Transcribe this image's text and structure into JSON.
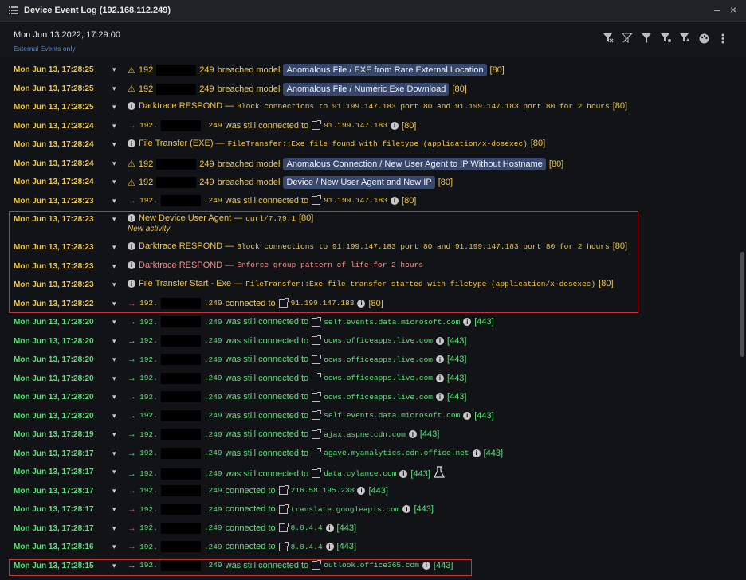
{
  "window": {
    "title": "Device Event Log (192.168.112.249)",
    "minimize": "–",
    "close": "×"
  },
  "header": {
    "date": "Mon Jun 13 2022, 17:29:00",
    "filter": "External Events only"
  },
  "toolbar": {
    "icons": [
      "filter-remove-icon",
      "filter-clear-icon",
      "filter-icon",
      "filter-models-icon",
      "filter-breach-icon",
      "palette-icon",
      "more-vert-icon"
    ]
  },
  "colors": {
    "timestamp_model": "#f0c84a",
    "timestamp_connection": "#5ee07a",
    "model_pill": "#37476e",
    "highlight_box": "#c8372f",
    "respond_text": "#f19090"
  },
  "rows": [
    {
      "time": "Mon Jun 13, 17:28:25",
      "ip_prefix": "192",
      "ip_suffix": "249",
      "text": "breached model",
      "model": "Anomalous File / EXE from Rare External Location",
      "score": "[80]"
    },
    {
      "time": "Mon Jun 13, 17:28:25",
      "ip_prefix": "192",
      "ip_suffix": "249",
      "text": "breached model",
      "model": "Anomalous File / Numeric Exe Download",
      "score": "[80]"
    },
    {
      "time": "Mon Jun 13, 17:28:25",
      "label": "Darktrace RESPOND —",
      "detail": "Block connections to 91.199.147.183 port 80 and 91.199.147.183 port 80 for 2 hours",
      "score": "[80]"
    },
    {
      "time": "Mon Jun 13, 17:28:24",
      "ip_prefix": "192.",
      "ip_suffix": ".249",
      "text": "was still connected to",
      "dest": "91.199.147.183",
      "score": "[80]"
    },
    {
      "time": "Mon Jun 13, 17:28:24",
      "label": "File Transfer (EXE) —",
      "detail": "FileTransfer::Exe file found with filetype (application/x-dosexec)",
      "score": "[80]"
    },
    {
      "time": "Mon Jun 13, 17:28:24",
      "ip_prefix": "192",
      "ip_suffix": "249",
      "text": "breached model",
      "model": "Anomalous Connection / New User Agent to IP Without Hostname",
      "score": "[80]"
    },
    {
      "time": "Mon Jun 13, 17:28:24",
      "ip_prefix": "192",
      "ip_suffix": "249",
      "text": "breached model",
      "model": "Device / New User Agent and New IP",
      "score": "[80]"
    },
    {
      "time": "Mon Jun 13, 17:28:23",
      "ip_prefix": "192.",
      "ip_suffix": ".249",
      "text": "was still connected to",
      "dest": "91.199.147.183",
      "score": "[80]"
    },
    {
      "time": "Mon Jun 13, 17:28:23",
      "label": "New Device User Agent —",
      "detail": "curl/7.79.1",
      "score": "[80]",
      "note": "New activity"
    },
    {
      "time": "Mon Jun 13, 17:28:23",
      "label": "Darktrace RESPOND —",
      "detail": "Block connections to 91.199.147.183 port 80 and 91.199.147.183 port 80 for 2 hours",
      "score": "[80]"
    },
    {
      "time": "Mon Jun 13, 17:28:23",
      "label": "Darktrace RESPOND —",
      "detail": "Enforce group pattern of life for 2 hours"
    },
    {
      "time": "Mon Jun 13, 17:28:23",
      "label": "File Transfer Start - Exe —",
      "detail": "FileTransfer::Exe file transfer started with filetype (application/x-dosexec)",
      "score": "[80]"
    },
    {
      "time": "Mon Jun 13, 17:28:22",
      "ip_prefix": "192.",
      "ip_suffix": ".249",
      "text": "connected to",
      "dest": "91.199.147.183",
      "score": "[80]"
    },
    {
      "time": "Mon Jun 13, 17:28:20",
      "ip_prefix": "192.",
      "ip_suffix": ".249",
      "text": "was still connected to",
      "dest": "self.events.data.microsoft.com",
      "score": "[443]"
    },
    {
      "time": "Mon Jun 13, 17:28:20",
      "ip_prefix": "192.",
      "ip_suffix": ".249",
      "text": "was still connected to",
      "dest": "ocws.officeapps.live.com",
      "score": "[443]"
    },
    {
      "time": "Mon Jun 13, 17:28:20",
      "ip_prefix": "192.",
      "ip_suffix": ".249",
      "text": "was still connected to",
      "dest": "ocws.officeapps.live.com",
      "score": "[443]"
    },
    {
      "time": "Mon Jun 13, 17:28:20",
      "ip_prefix": "192.",
      "ip_suffix": ".249",
      "text": "was still connected to",
      "dest": "ocws.officeapps.live.com",
      "score": "[443]"
    },
    {
      "time": "Mon Jun 13, 17:28:20",
      "ip_prefix": "192.",
      "ip_suffix": ".249",
      "text": "was still connected to",
      "dest": "ocws.officeapps.live.com",
      "score": "[443]"
    },
    {
      "time": "Mon Jun 13, 17:28:20",
      "ip_prefix": "192.",
      "ip_suffix": ".249",
      "text": "was still connected to",
      "dest": "self.events.data.microsoft.com",
      "score": "[443]"
    },
    {
      "time": "Mon Jun 13, 17:28:19",
      "ip_prefix": "192.",
      "ip_suffix": ".249",
      "text": "was still connected to",
      "dest": "ajax.aspnetcdn.com",
      "score": "[443]"
    },
    {
      "time": "Mon Jun 13, 17:28:17",
      "ip_prefix": "192.",
      "ip_suffix": ".249",
      "text": "was still connected to",
      "dest": "agave.myanalytics.cdn.office.net",
      "score": "[443]"
    },
    {
      "time": "Mon Jun 13, 17:28:17",
      "ip_prefix": "192.",
      "ip_suffix": ".249",
      "text": "was still connected to",
      "dest": "data.cylance.com",
      "score": "[443]"
    },
    {
      "time": "Mon Jun 13, 17:28:17",
      "ip_prefix": "192.",
      "ip_suffix": ".249",
      "text": "connected to",
      "dest": "216.58.195.238",
      "score": "[443]"
    },
    {
      "time": "Mon Jun 13, 17:28:17",
      "ip_prefix": "192.",
      "ip_suffix": ".249",
      "text": "connected to",
      "dest": "translate.googleapis.com",
      "score": "[443]"
    },
    {
      "time": "Mon Jun 13, 17:28:17",
      "ip_prefix": "192.",
      "ip_suffix": ".249",
      "text": "connected to",
      "dest": "8.8.4.4",
      "score": "[443]"
    },
    {
      "time": "Mon Jun 13, 17:28:16",
      "ip_prefix": "192.",
      "ip_suffix": ".249",
      "text": "connected to",
      "dest": "8.8.4.4",
      "score": "[443]"
    },
    {
      "time": "Mon Jun 13, 17:28:15",
      "ip_prefix": "192.",
      "ip_suffix": ".249",
      "text": "was still connected to",
      "dest": "outlook.office365.com",
      "score": "[443]"
    }
  ]
}
